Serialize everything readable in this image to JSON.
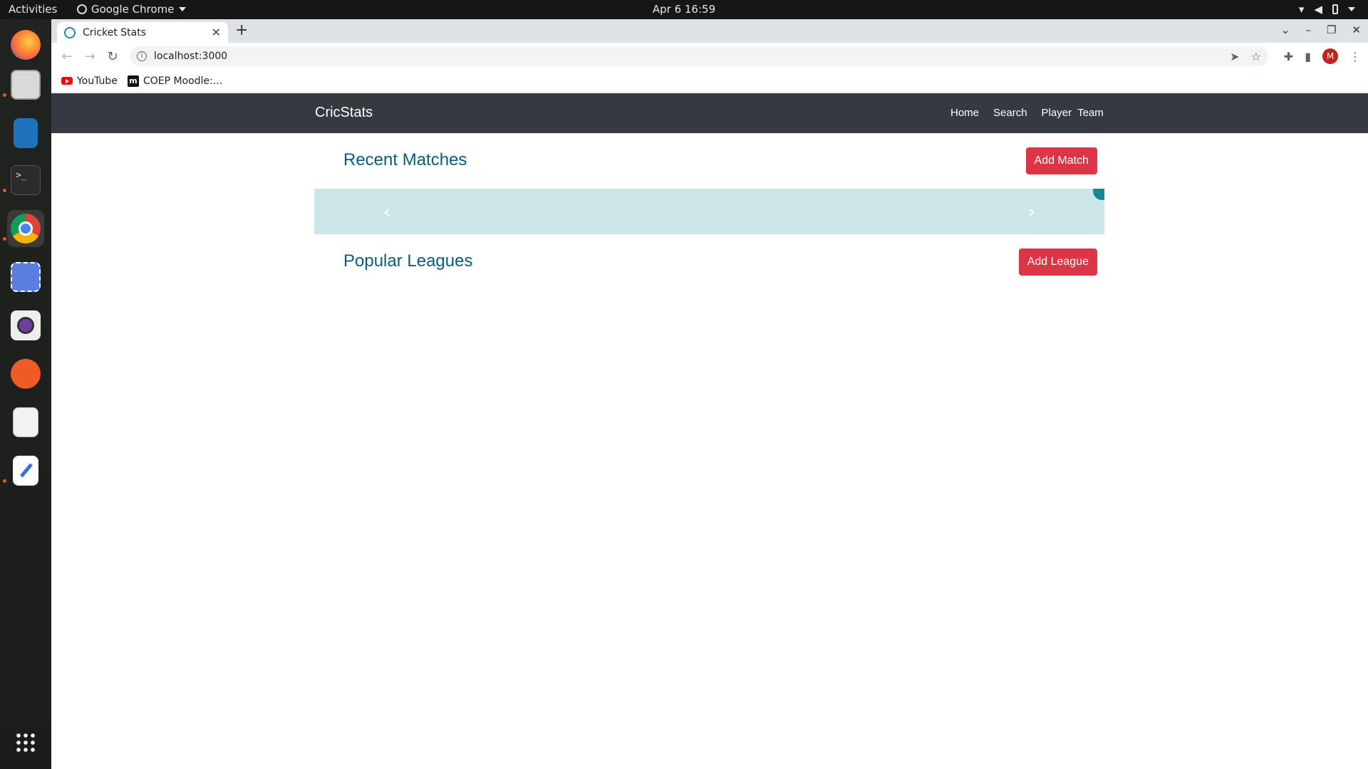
{
  "desktop": {
    "activities_label": "Activities",
    "app_menu_label": "Google Chrome",
    "clock": "Apr 6  16:59"
  },
  "dock": {
    "apps": [
      "firefox-icon",
      "files-icon",
      "libreoffice-writer-icon",
      "terminal-icon",
      "chrome-icon",
      "screenshot-icon",
      "camera-icon",
      "postman-icon",
      "document-viewer-icon",
      "text-editor-icon",
      "show-apps-icon"
    ]
  },
  "browser": {
    "tab_title": "Cricket Stats",
    "url": "localhost:3000",
    "avatar_letter": "M",
    "bookmarks": [
      "YouTube",
      "COEP Moodle:..."
    ]
  },
  "page": {
    "brand": "CricStats",
    "nav": [
      "Home",
      "Search",
      "Player",
      "Team"
    ],
    "recent_matches_title": "Recent Matches",
    "add_match_label": "Add Match",
    "popular_leagues_title": "Popular Leagues",
    "add_league_label": "Add League",
    "colors": {
      "navbar": "#343a40",
      "heading": "#0c5b79",
      "button": "#dc3545",
      "carousel_bg": "#cce5e7"
    }
  }
}
